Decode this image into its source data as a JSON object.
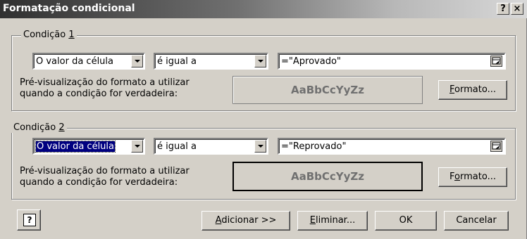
{
  "window": {
    "title": "Formatação condicional",
    "help_button": "?",
    "close_button": "×"
  },
  "conditions": [
    {
      "legend_prefix": "Condição ",
      "legend_number": "1",
      "operand_type": "O valor da célula",
      "operator": "é igual a",
      "value": "=\"Aprovado\"",
      "preview_label_line1": "Pré-visualização do formato a utilizar",
      "preview_label_line2": "quando a condição for verdadeira:",
      "preview_sample": "AaBbCcYyZz",
      "format_button_pre": "",
      "format_button_u": "F",
      "format_button_post": "ormato..."
    },
    {
      "legend_prefix": "Condição ",
      "legend_number": "2",
      "operand_type": "O valor da célula",
      "operator": "é igual a",
      "value": "=\"Reprovado\"",
      "preview_label_line1": "Pré-visualização do formato a utilizar",
      "preview_label_line2": "quando a condição for verdadeira:",
      "preview_sample": "AaBbCcYyZz",
      "format_button_pre": "F",
      "format_button_u": "o",
      "format_button_post": "rmato..."
    }
  ],
  "footer": {
    "help_icon": "?",
    "add_pre": "",
    "add_u": "A",
    "add_post": "dicionar >>",
    "delete_pre": "",
    "delete_u": "E",
    "delete_post": "liminar...",
    "ok": "OK",
    "cancel": "Cancelar"
  }
}
